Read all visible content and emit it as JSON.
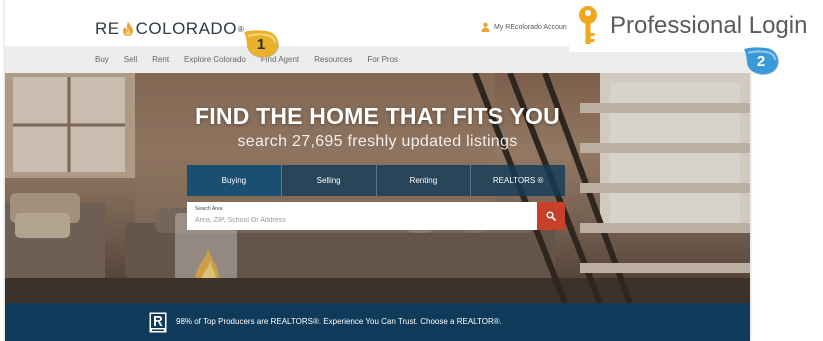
{
  "header": {
    "logo_left": "RE",
    "logo_right": "COLORADO",
    "logo_reg": "®",
    "account_link": "My REcolorado Accoun"
  },
  "nav": {
    "items": [
      {
        "label": "Buy"
      },
      {
        "label": "Sell"
      },
      {
        "label": "Rent"
      },
      {
        "label": "Explore Colorado"
      },
      {
        "label": "Find Agent"
      },
      {
        "label": "Resources"
      },
      {
        "label": "For Pros"
      }
    ]
  },
  "hero": {
    "headline": "FIND THE HOME THAT FITS YOU",
    "subline": "search 27,695 freshly updated listings"
  },
  "search_tabs": [
    {
      "label": "Buying",
      "active": true
    },
    {
      "label": "Selling",
      "active": false
    },
    {
      "label": "Renting",
      "active": false
    },
    {
      "label": "REALTORS ®",
      "active": false
    }
  ],
  "search": {
    "label": "Search Area",
    "placeholder": "Area, ZIP, School Or Address",
    "button_icon": "search-icon"
  },
  "band": {
    "text": "98% of Top Producers are REALTORS®. Experience You Can Trust. Choose a REALTOR®."
  },
  "annotations": {
    "badge_1": "1",
    "badge_2": "2",
    "professional_login": "Professional Login",
    "key_icon": "key-icon"
  },
  "colors": {
    "nav_bg": "#ececec",
    "tab_active": "#1b4f72",
    "search_button": "#c8402a",
    "band_bg": "#0f3a5a",
    "badge_gold": "#e8b12c",
    "badge_blue": "#3a9ad9"
  }
}
